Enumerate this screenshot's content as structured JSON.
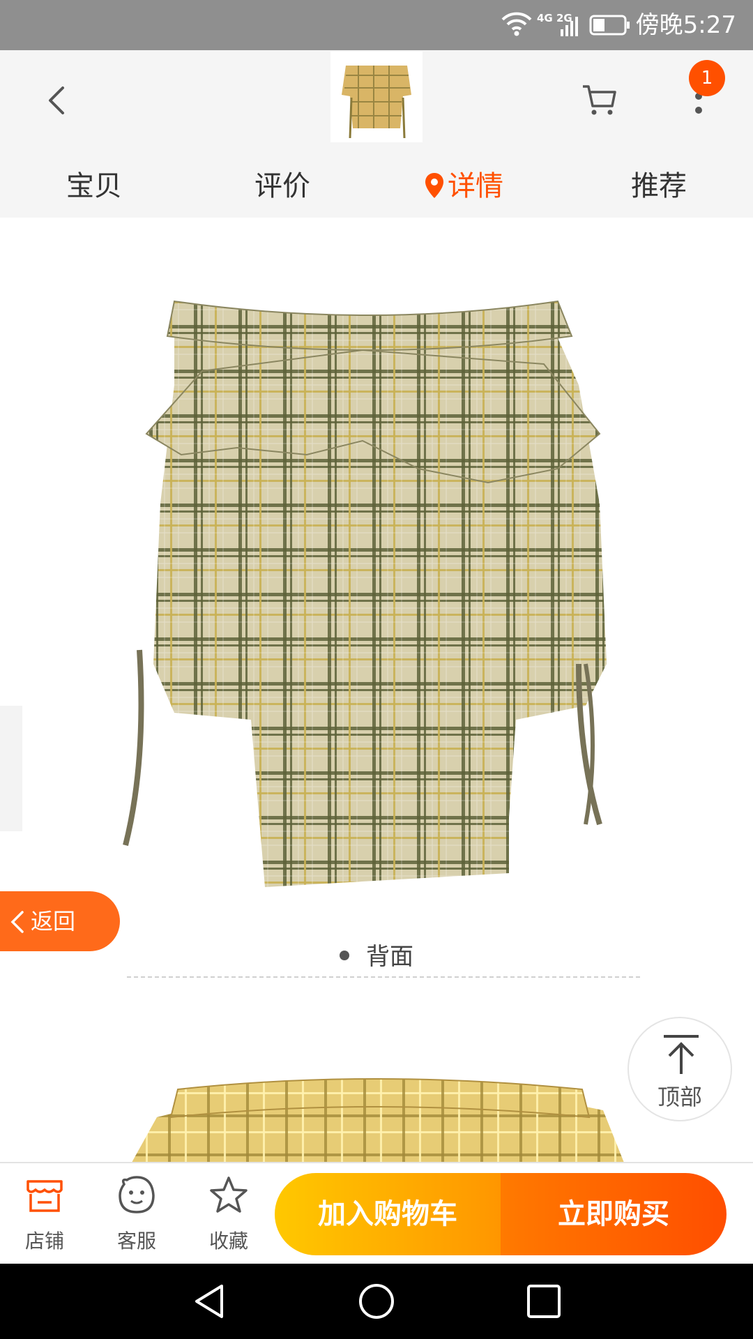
{
  "status_bar": {
    "network": "4G 2G",
    "time": "傍晚5:27"
  },
  "header": {
    "cart_badge": "1",
    "tabs": [
      {
        "label": "宝贝"
      },
      {
        "label": "评价"
      },
      {
        "label": "详情",
        "active": true
      },
      {
        "label": "推荐"
      }
    ]
  },
  "content": {
    "image_caption": "背面"
  },
  "floating": {
    "return_label": "返回",
    "top_label": "顶部"
  },
  "action_bar": {
    "shop_label": "店铺",
    "service_label": "客服",
    "favorite_label": "收藏",
    "add_to_cart_label": "加入购物车",
    "buy_now_label": "立即购买"
  },
  "colors": {
    "accent": "#ff5000",
    "cart_gradient": [
      "#ffc800",
      "#ff9600"
    ],
    "buy_gradient": [
      "#ff7a00",
      "#ff4e00"
    ]
  }
}
